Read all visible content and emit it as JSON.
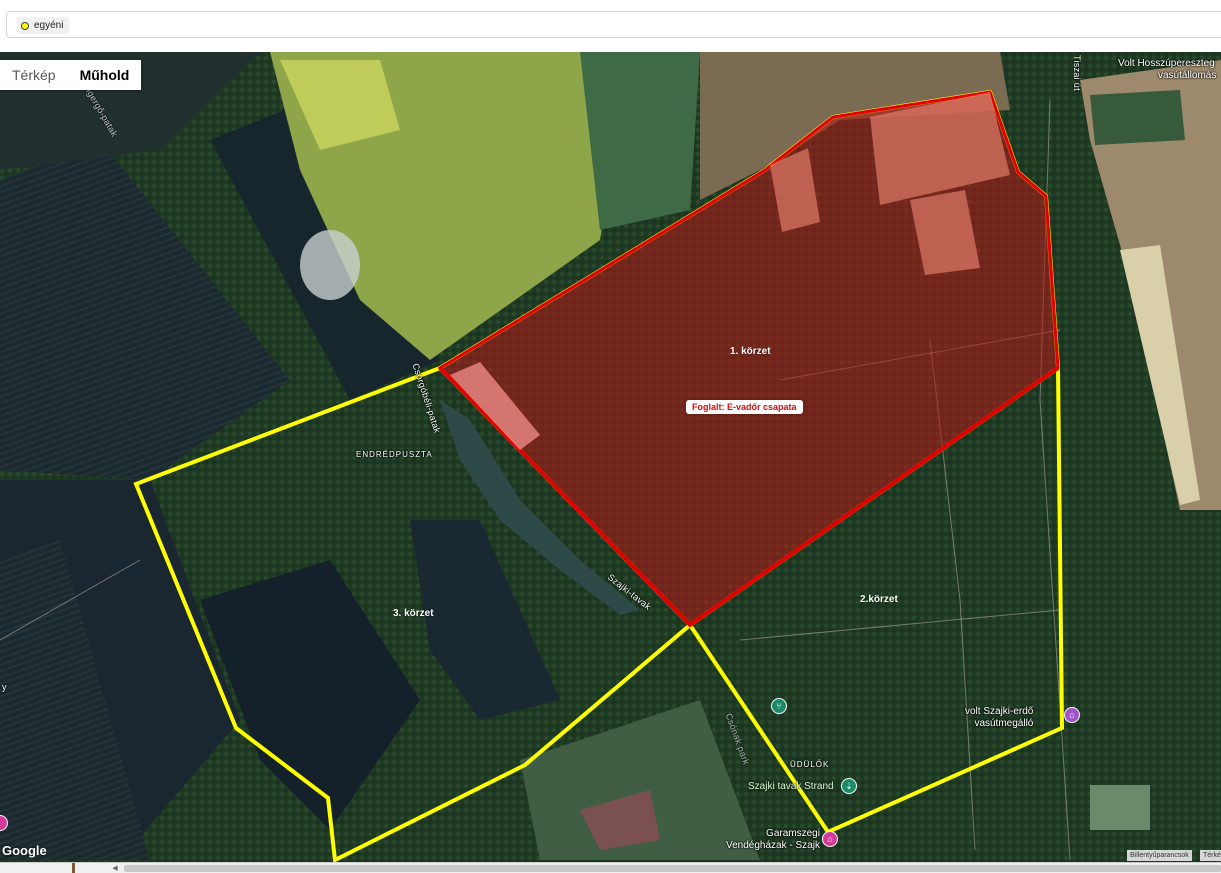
{
  "filter": {
    "chip_label": "egyéni",
    "chip_color": "#ffff00"
  },
  "map_type": {
    "options": [
      "Térkép",
      "Műhold"
    ],
    "selected": "Műhold"
  },
  "zones": [
    {
      "label": "1. körzet",
      "border_color": "#ffff00"
    },
    {
      "label": "2.körzet",
      "border_color": "#ffff00"
    },
    {
      "label": "3. körzet",
      "border_color": "#ffff00"
    }
  ],
  "occupied_area": {
    "label": "Foglalt: E-vadőr csapata",
    "fill_color": "#c01818",
    "border_color": "#e00000"
  },
  "place_labels": {
    "endredpuszta": "ENDRÉDPUSZTA",
    "szajki_tavak": "Szajki-tavak",
    "csongo_patak": "Csorgóbéli-patak",
    "udulok": "ÜDÜLŐK",
    "park": "Csónak park",
    "patak_nw": "Ingergő-patak",
    "road_top": "Tiszai út",
    "station_top_line1": "Volt Hosszúpereszteg",
    "station_top_line2": "vasútállomás",
    "strand": "Szajki tavak Strand",
    "station_bottom_line1": "volt Szajki-erdő",
    "station_bottom_line2": "vasútmegálló",
    "guesthouse_line1": "Garamszegi",
    "guesthouse_line2": "Vendégházak - Szajk",
    "left_edge": "y"
  },
  "branding": {
    "google": "Google",
    "keyboard": "Billentyűparancsok",
    "map_data": "Térké"
  }
}
